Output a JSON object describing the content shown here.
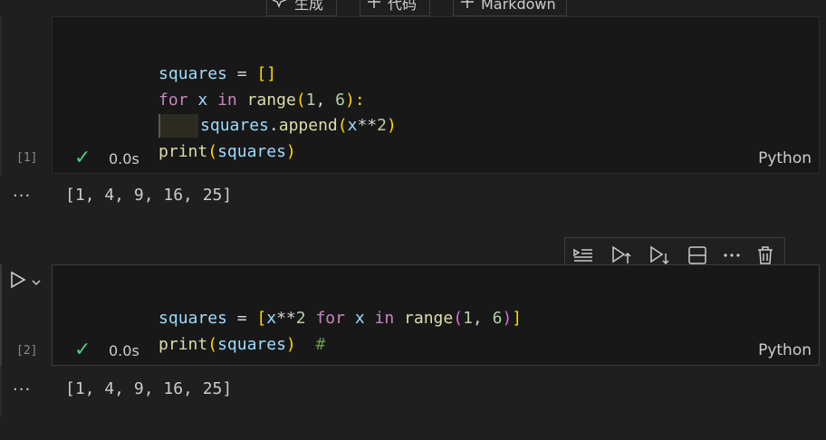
{
  "insert_toolbar": {
    "generate_label": "生成",
    "code_label": "代码",
    "markdown_label": "Markdown"
  },
  "cells": [
    {
      "exec_count": "[1]",
      "lines": [
        [
          "squares",
          " = ",
          "[]"
        ],
        [
          "for",
          " x ",
          "in",
          " ",
          "range",
          "(",
          "1",
          ", ",
          "6",
          "):"
        ],
        [
          "squares",
          ".",
          "append",
          "(",
          "x",
          "**",
          "2",
          ")"
        ],
        [
          "print",
          "(",
          "squares",
          ")"
        ]
      ],
      "status_time": "0.0s",
      "language": "Python",
      "output": "[1, 4, 9, 16, 25]",
      "output_menu": "···"
    },
    {
      "exec_count": "[2]",
      "lines": [
        [
          "squares",
          " = ",
          "[",
          "x",
          "**",
          "2",
          " ",
          "for",
          " ",
          "x",
          " ",
          "in",
          " ",
          "range",
          "(",
          "1",
          ", ",
          "6",
          ")",
          "]"
        ],
        [
          "print",
          "(",
          "squares",
          ")",
          "  ",
          "#"
        ]
      ],
      "status_time": "0.0s",
      "language": "Python",
      "output": "[1, 4, 9, 16, 25]",
      "output_menu": "···"
    }
  ],
  "cell_toolbar": {
    "icons": [
      "execute-above-and-below-icon",
      "run-above-icon",
      "run-below-icon",
      "split-cell-icon",
      "more-actions-icon",
      "delete-cell-icon"
    ]
  },
  "colors": {
    "background": "#1f1f1f",
    "cell_background": "#181818",
    "check_green": "#4ec97b",
    "variable": "#9cdcfe",
    "keyword": "#c586c0",
    "function": "#dcdcaa",
    "number": "#b5cea8",
    "bracket_1": "#ffd700",
    "bracket_2": "#da70d6",
    "comment": "#6a9955"
  }
}
